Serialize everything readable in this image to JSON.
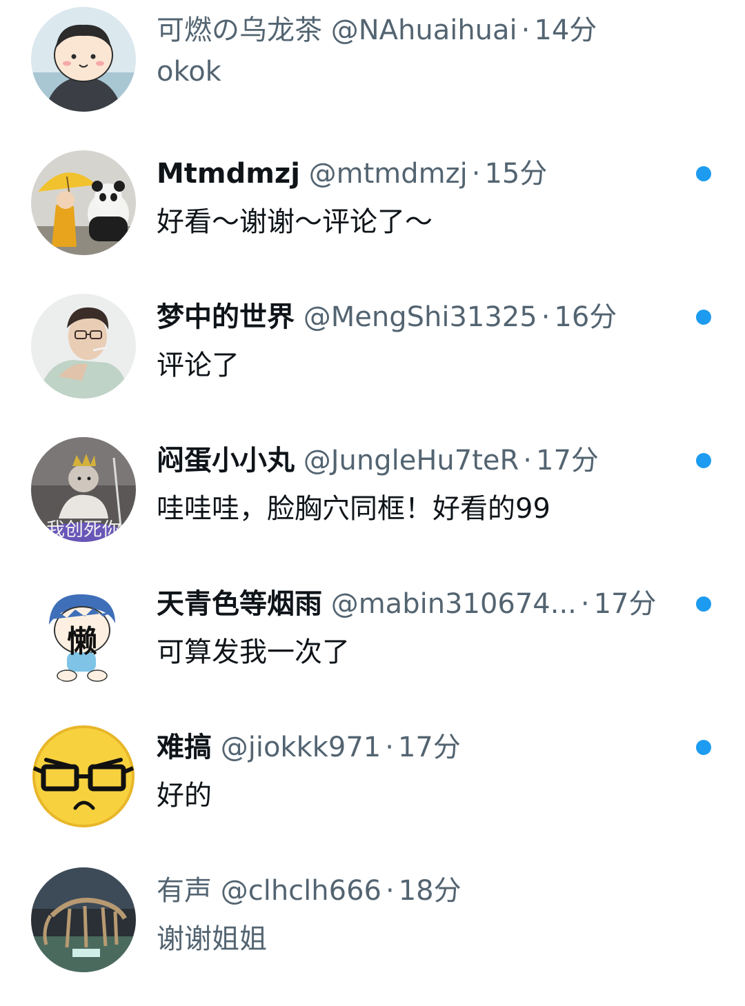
{
  "accent_color": "#1d9bf0",
  "comments": [
    {
      "display_name": "可燃の乌龙茶",
      "handle": "@NAhuaihuai",
      "separator": "·",
      "time": "14分",
      "text": "okok",
      "unread": false,
      "avatar_icon": "cartoon-man-avatar-icon"
    },
    {
      "display_name": "Mtmdmzj",
      "handle": "@mtmdmzj",
      "separator": "·",
      "time": "15分",
      "text": "好看～谢谢～评论了～",
      "unread": true,
      "avatar_icon": "girl-with-umbrella-and-panda-avatar-icon"
    },
    {
      "display_name": "梦中的世界",
      "handle": "@MengShi31325",
      "separator": "·",
      "time": "16分",
      "text": "评论了",
      "unread": true,
      "avatar_icon": "man-with-glasses-sketch-avatar-icon"
    },
    {
      "display_name": "闷蛋小小丸",
      "handle": "@JungleHu7teR",
      "separator": "·",
      "time": "17分",
      "text": "哇哇哇，脸胸穴同框！好看的99",
      "unread": true,
      "avatar_icon": "cat-on-toy-scooter-avatar-icon",
      "avatar_caption": "我创死你"
    },
    {
      "display_name": "天青色等烟雨",
      "handle": "@mabin310674...",
      "separator": "·",
      "time": "17分",
      "text": "可算发我一次了",
      "unread": true,
      "avatar_icon": "lazy-cartoon-boy-avatar-icon",
      "avatar_caption": "懒"
    },
    {
      "display_name": "难搞",
      "handle": "@jiokkk971",
      "separator": "·",
      "time": "17分",
      "text": "好的",
      "unread": true,
      "avatar_icon": "emoji-face-with-glasses-avatar-icon"
    },
    {
      "display_name": "有声",
      "handle": "@clhclh666",
      "separator": "·",
      "time": "18分",
      "text": "谢谢姐姐",
      "unread": false,
      "avatar_icon": "dinosaur-skeleton-museum-avatar-icon"
    }
  ]
}
